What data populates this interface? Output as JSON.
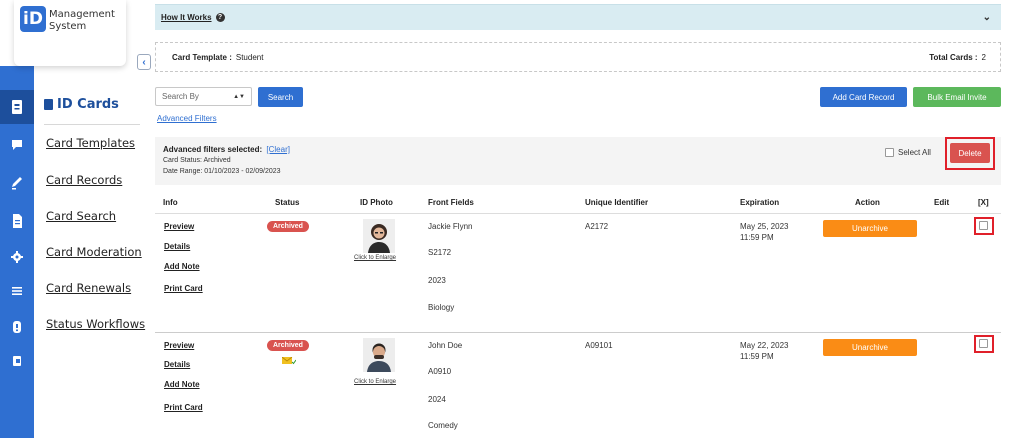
{
  "app": {
    "logo_mark": "iD",
    "name_line1": "Management",
    "name_line2": "System"
  },
  "sidebar": {
    "heading": "ID Cards",
    "items": [
      {
        "label": "Card Templates"
      },
      {
        "label": "Card Records"
      },
      {
        "label": "Card Search"
      },
      {
        "label": "Card Moderation"
      },
      {
        "label": "Card Renewals"
      },
      {
        "label": "Status Workflows"
      }
    ]
  },
  "rail_icons": [
    "id-card-icon",
    "chat-icon",
    "pen-icon",
    "document-icon",
    "gear-icon",
    "list-icon",
    "help-icon",
    "logout-icon"
  ],
  "how_it_works": {
    "title": "How It Works"
  },
  "template_bar": {
    "label": "Card Template :",
    "value": "Student",
    "total_label": "Total Cards :",
    "total_value": "2"
  },
  "search": {
    "placeholder": "Search By",
    "button": "Search",
    "advanced_link": "Advanced Filters"
  },
  "toolbar": {
    "add_record": "Add Card Record",
    "bulk_email": "Bulk Email Invite"
  },
  "filters": {
    "title": "Advanced filters selected:",
    "clear": "[Clear]",
    "status_line": "Card Status: Archived",
    "date_line": "Date Range: 01/10/2023 - 02/09/2023",
    "select_all": "Select All",
    "delete": "Delete"
  },
  "table": {
    "headers": [
      "Info",
      "Status",
      "ID Photo",
      "Front Fields",
      "Unique Identifier",
      "Expiration",
      "Action",
      "Edit",
      "[X]"
    ],
    "info_links": [
      "Preview",
      "Details",
      "Add Note",
      "Print Card"
    ],
    "enlarge_label": "Click to Enlarge",
    "rows": [
      {
        "status": "Archived",
        "front_fields": [
          "Jackie Flynn",
          "S2172",
          "2023",
          "Biology"
        ],
        "unique_id": "A2172",
        "expiration_date": "May 25, 2023",
        "expiration_time": "11:59 PM",
        "action": "Unarchive"
      },
      {
        "status": "Archived",
        "front_fields": [
          "John Doe",
          "A0910",
          "2024",
          "Comedy"
        ],
        "unique_id": "A09101",
        "expiration_date": "May 22, 2023",
        "expiration_time": "11:59 PM",
        "action": "Unarchive"
      }
    ]
  },
  "colors": {
    "primary": "#2f6fd1",
    "rail_active": "#1d4f9c",
    "success": "#5cb85c",
    "danger": "#d9534f",
    "warning": "#fa8c15",
    "highlight": "#e0202a",
    "info_bar": "#d9ecf2"
  }
}
